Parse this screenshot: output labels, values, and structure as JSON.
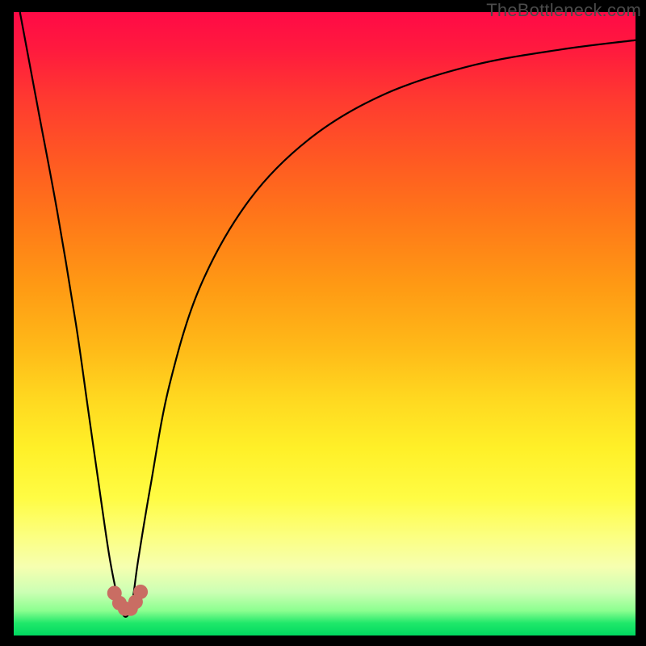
{
  "watermark": "TheBottleneck.com",
  "colors": {
    "curve_stroke": "#000000",
    "dot_fill": "#c96d63"
  },
  "chart_data": {
    "type": "line",
    "title": "",
    "xlabel": "",
    "ylabel": "",
    "xlim": [
      0,
      100
    ],
    "ylim": [
      0,
      100
    ],
    "grid": false,
    "legend": false,
    "series": [
      {
        "name": "bottleneck-curve",
        "x": [
          1,
          4,
          7,
          10,
          12,
          14,
          15.5,
          17,
          18,
          19,
          20,
          22,
          25,
          30,
          38,
          48,
          60,
          74,
          88,
          100
        ],
        "y": [
          100,
          84,
          68,
          50,
          36,
          22,
          12,
          5,
          3,
          5,
          12,
          24,
          40,
          56,
          70,
          80,
          87,
          91.5,
          94,
          95.5
        ]
      }
    ],
    "markers": [
      {
        "x": 16.2,
        "y": 6.8
      },
      {
        "x": 17.0,
        "y": 5.2
      },
      {
        "x": 17.9,
        "y": 4.3
      },
      {
        "x": 18.8,
        "y": 4.3
      },
      {
        "x": 19.6,
        "y": 5.4
      },
      {
        "x": 20.4,
        "y": 7.0
      }
    ]
  }
}
